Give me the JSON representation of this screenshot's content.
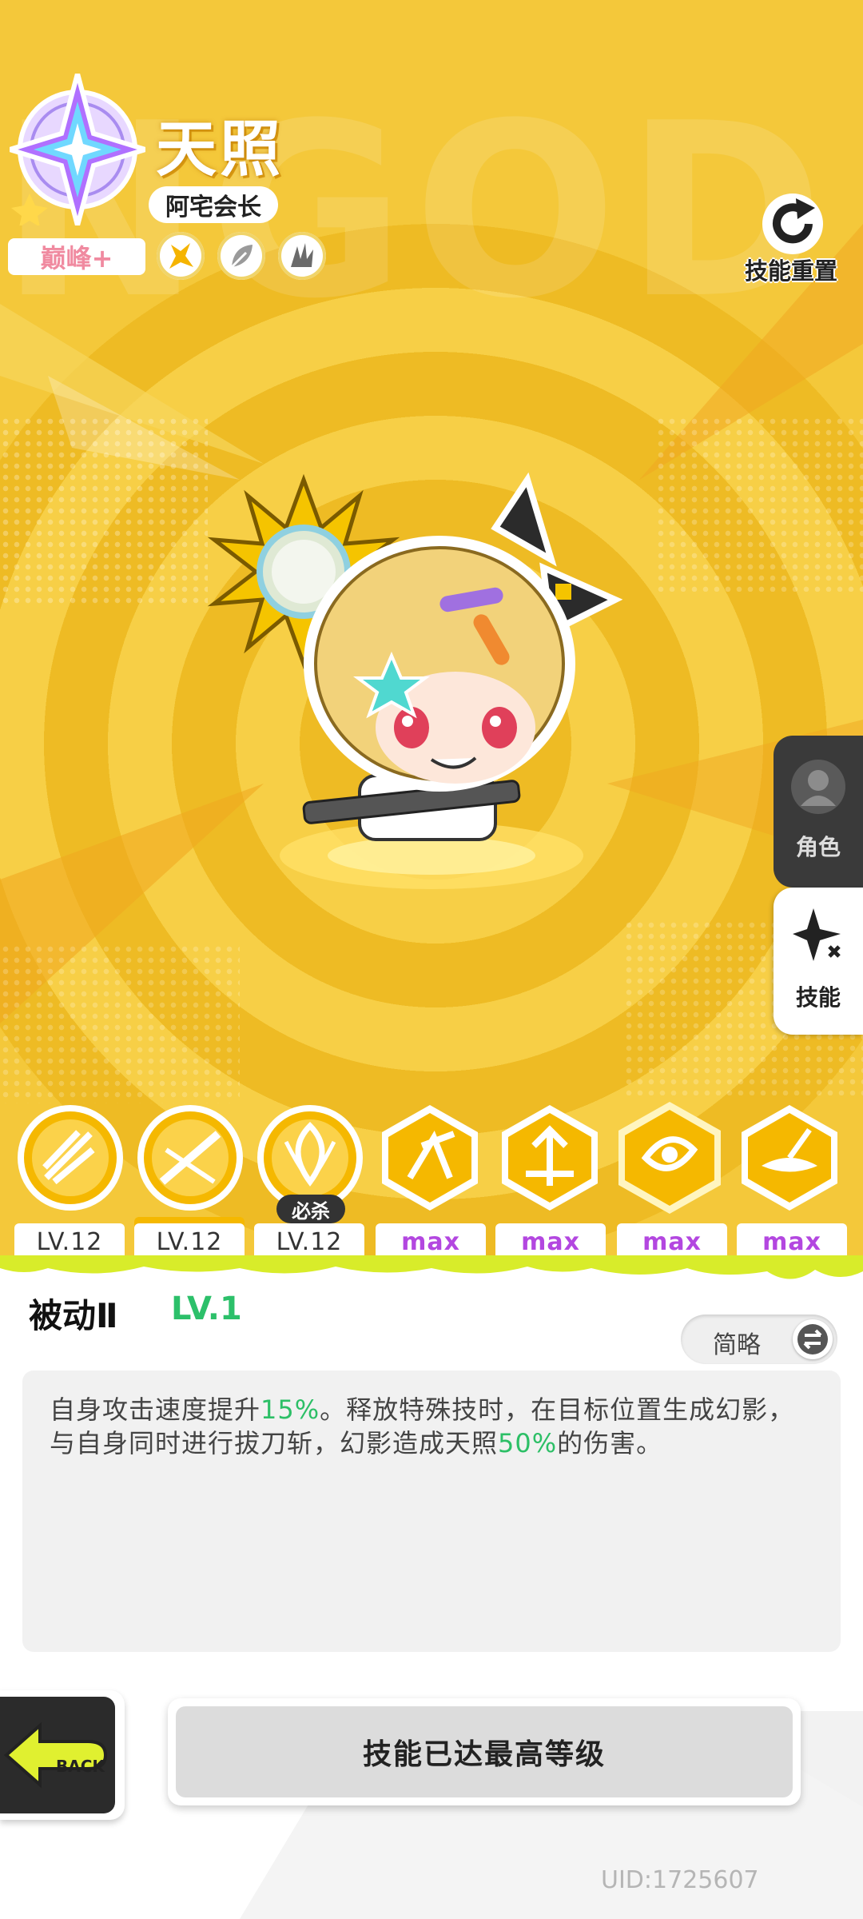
{
  "character": {
    "name": "天照",
    "title": "阿宅会长",
    "rank": "巅峰+"
  },
  "header": {
    "reset_label": "技能重置"
  },
  "side_tabs": {
    "role_label": "角色",
    "skill_label": "技能"
  },
  "skills": [
    {
      "level": "LV.12",
      "max": false
    },
    {
      "level": "LV.12",
      "max": false
    },
    {
      "level": "LV.12",
      "max": false,
      "tag": "必杀"
    },
    {
      "level": "max",
      "max": true
    },
    {
      "level": "max",
      "max": true
    },
    {
      "level": "max",
      "max": true,
      "selected": true
    },
    {
      "level": "max",
      "max": true
    }
  ],
  "selected_skill": {
    "name": "被动Ⅱ",
    "level": "LV.1",
    "toggle_label": "简略",
    "description": {
      "line1_a": "自身攻击速度提升",
      "line1_hl": "15%",
      "line1_b": "。释放特殊技时，在目标位置生成幻影，",
      "line2_a": "与自身同时进行拔刀斩，幻影造成天照",
      "line2_hl": "50%",
      "line2_b": "的伤害。"
    }
  },
  "footer": {
    "back_label": "BACK",
    "max_level_label": "技能已达最高等级",
    "uid": "UID:1725607"
  },
  "colors": {
    "background_yellow": "#f3c02f",
    "highlight_green": "#2cbf66",
    "max_purple": "#b347e0"
  },
  "icons": [
    "star-badge-icon",
    "element-lightning-icon",
    "element-leaf-icon",
    "element-claw-icon",
    "reset-icon",
    "person-icon",
    "sparkle-icon",
    "swap-icon",
    "back-arrow-icon"
  ]
}
